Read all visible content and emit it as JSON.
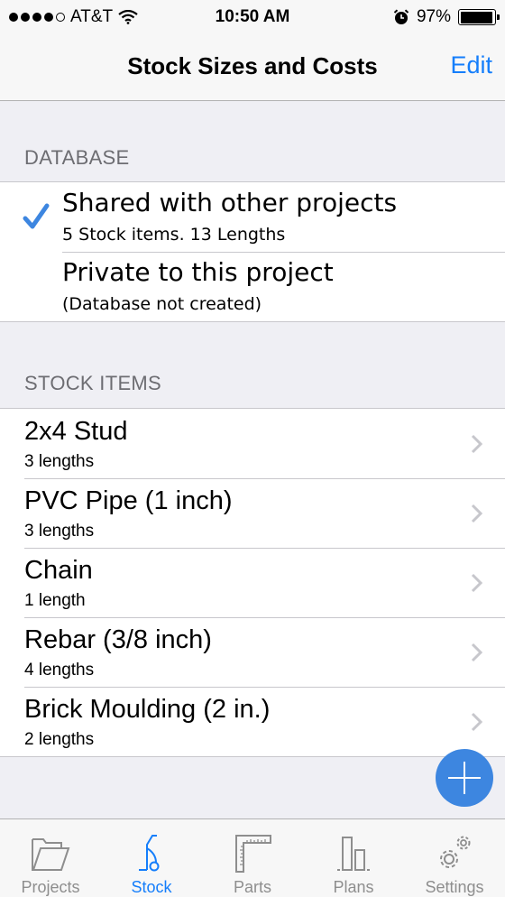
{
  "status_bar": {
    "signal_dots_filled": 4,
    "signal_dots_total": 5,
    "carrier": "AT&T",
    "time": "10:50 AM",
    "battery_percent_label": "97%",
    "battery_level": 0.97
  },
  "nav": {
    "title": "Stock Sizes and Costs",
    "edit_label": "Edit"
  },
  "database": {
    "header": "DATABASE",
    "options": [
      {
        "title": "Shared with other projects",
        "subtitle": "5 Stock items. 13 Lengths",
        "selected": true
      },
      {
        "title": "Private to this project",
        "subtitle": "(Database not created)",
        "selected": false
      }
    ]
  },
  "stock_items": {
    "header": "STOCK ITEMS",
    "items": [
      {
        "name": "2x4 Stud",
        "lengths": "3 lengths"
      },
      {
        "name": "PVC Pipe (1 inch)",
        "lengths": "3 lengths"
      },
      {
        "name": "Chain",
        "lengths": "1 length"
      },
      {
        "name": "Rebar (3/8 inch)",
        "lengths": "4 lengths"
      },
      {
        "name": "Brick Moulding (2 in.)",
        "lengths": "2 lengths"
      }
    ]
  },
  "fab": {
    "icon": "plus-icon"
  },
  "tab_bar": {
    "tabs": [
      {
        "label": "Projects",
        "icon": "folder-icon",
        "active": false
      },
      {
        "label": "Stock",
        "icon": "hand-truck-icon",
        "active": true
      },
      {
        "label": "Parts",
        "icon": "carpenter-square-icon",
        "active": false
      },
      {
        "label": "Plans",
        "icon": "bar-chart-icon",
        "active": false
      },
      {
        "label": "Settings",
        "icon": "gears-icon",
        "active": false
      }
    ]
  },
  "colors": {
    "accent": "#157efb",
    "check": "#3d86e0",
    "fab": "#3d86e0",
    "section_text": "#6d6d72",
    "background": "#efeff4",
    "tab_inactive": "#8e8e8e"
  }
}
